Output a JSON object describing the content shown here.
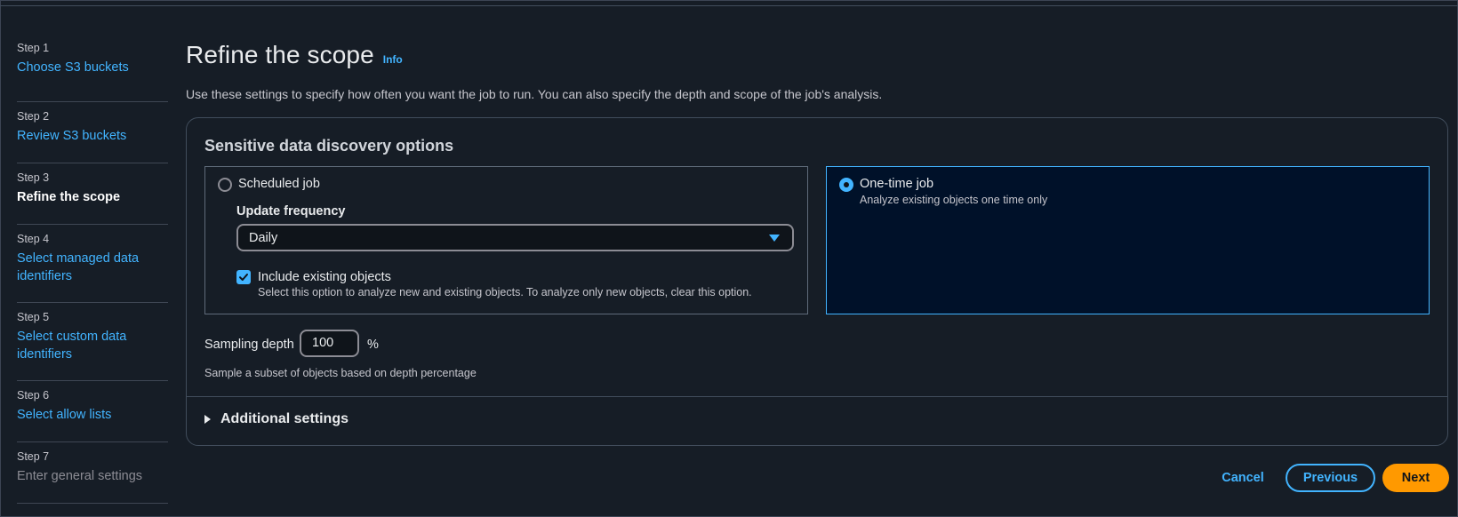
{
  "steps": [
    {
      "num": "Step 1",
      "label": "Choose S3 buckets",
      "state": "link"
    },
    {
      "num": "Step 2",
      "label": "Review S3 buckets",
      "state": "link"
    },
    {
      "num": "Step 3",
      "label": "Refine the scope",
      "state": "current"
    },
    {
      "num": "Step 4",
      "label": "Select managed data identifiers",
      "state": "link"
    },
    {
      "num": "Step 5",
      "label": "Select custom data identifiers",
      "state": "link"
    },
    {
      "num": "Step 6",
      "label": "Select allow lists",
      "state": "link"
    },
    {
      "num": "Step 7",
      "label": "Enter general settings",
      "state": "disabled"
    }
  ],
  "header": {
    "title": "Refine the scope",
    "info": "Info",
    "description": "Use these settings to specify how often you want the job to run. You can also specify the depth and scope of the job's analysis."
  },
  "options": {
    "title": "Sensitive data discovery options",
    "scheduled": {
      "label": "Scheduled job",
      "selected": false,
      "frequency_label": "Update frequency",
      "frequency_value": "Daily",
      "include_label": "Include existing objects",
      "include_checked": true,
      "include_desc": "Select this option to analyze new and existing objects. To analyze only new objects, clear this option."
    },
    "onetime": {
      "label": "One-time job",
      "selected": true,
      "desc": "Analyze existing objects one time only"
    },
    "sampling": {
      "label": "Sampling depth",
      "value": "100",
      "unit": "%",
      "desc": "Sample a subset of objects based on depth percentage"
    },
    "additional": "Additional settings"
  },
  "footer": {
    "cancel": "Cancel",
    "previous": "Previous",
    "next": "Next"
  },
  "colors": {
    "link": "#42b4ff",
    "primary": "#ff9900",
    "background": "#161d26"
  }
}
